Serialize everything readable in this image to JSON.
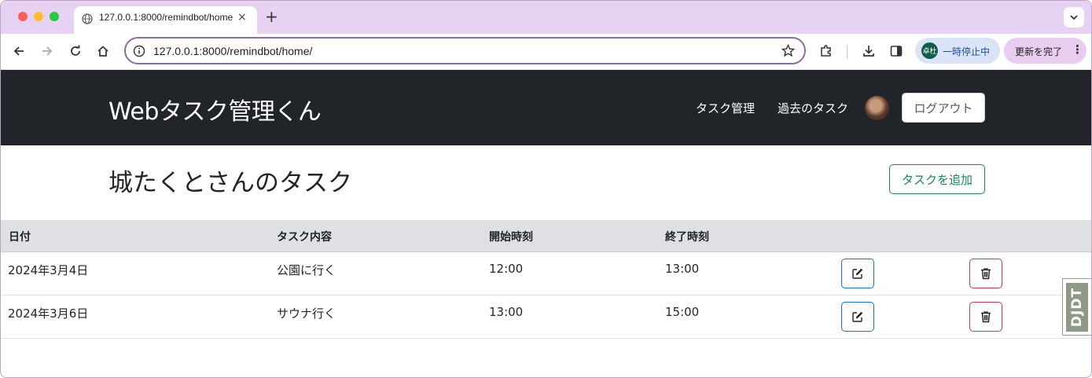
{
  "browser": {
    "tab_title": "127.0.0.1:8000/remindbot/home/",
    "tab_close": "×",
    "new_tab": "+",
    "url": "127.0.0.1:8000/remindbot/home/",
    "profile_initials": "卓杜",
    "paused_label": "一時停止中",
    "update_label": "更新を完了",
    "update_menu": "⋮"
  },
  "navbar": {
    "brand": "Webタスク管理くん",
    "links": [
      "タスク管理",
      "過去のタスク"
    ],
    "logout_label": "ログアウト"
  },
  "main": {
    "heading": "城たくとさんのタスク",
    "add_task_label": "タスクを追加"
  },
  "table": {
    "headers": [
      "日付",
      "タスク内容",
      "開始時刻",
      "終了時刻"
    ],
    "rows": [
      {
        "date": "2024年3月4日",
        "task": "公園に行く",
        "start": "12:00",
        "end": "13:00"
      },
      {
        "date": "2024年3月6日",
        "task": "サウナ行く",
        "start": "13:00",
        "end": "15:00"
      }
    ]
  },
  "debug_toolbar": {
    "label": "DJDT"
  },
  "colors": {
    "tab_strip": "#e8d2f3",
    "navbar": "#212529",
    "add_button": "#198754",
    "edit_button": "#0d6efd",
    "delete_button": "#dc3545",
    "table_header": "#dee0e3"
  }
}
